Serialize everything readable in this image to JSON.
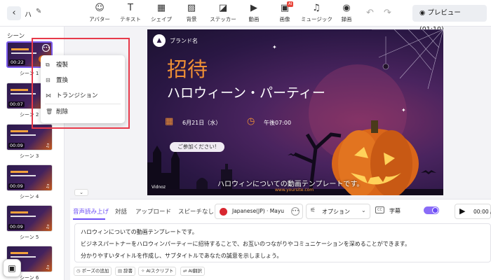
{
  "toolbar": {
    "back_icon": "chevron-left-icon",
    "project_name": "ハ",
    "tools": [
      {
        "label": "アバター",
        "icon": "avatar-icon",
        "glyph": "☺"
      },
      {
        "label": "テキスト",
        "icon": "text-icon",
        "glyph": "T"
      },
      {
        "label": "シェイプ",
        "icon": "shapes-icon",
        "glyph": "▦"
      },
      {
        "label": "背景",
        "icon": "background-icon",
        "glyph": "▨"
      },
      {
        "label": "ステッカー",
        "icon": "sticker-icon",
        "glyph": "◪"
      },
      {
        "label": "動画",
        "icon": "video-icon",
        "glyph": "▶"
      },
      {
        "label": "画像",
        "icon": "image-icon",
        "glyph": "▣",
        "badge": "AI"
      },
      {
        "label": "ミュージック",
        "icon": "music-icon",
        "glyph": "♫"
      },
      {
        "label": "録画",
        "icon": "record-icon",
        "glyph": "◉"
      }
    ],
    "preview_label": "プレビュー (01:10)"
  },
  "sidebar": {
    "title": "シーン",
    "scenes": [
      {
        "label": "シーン 1",
        "duration": "00:22"
      },
      {
        "label": "シーン 2",
        "duration": "00:07"
      },
      {
        "label": "シーン 3",
        "duration": "00:09"
      },
      {
        "label": "シーン 4",
        "duration": "00:09"
      },
      {
        "label": "シーン 5",
        "duration": "00:09"
      },
      {
        "label": "シーン 6",
        "duration": ""
      }
    ]
  },
  "context_menu": {
    "items": [
      {
        "label": "複製",
        "icon": "duplicate-icon"
      },
      {
        "label": "置換",
        "icon": "replace-icon"
      },
      {
        "label": "トランジション",
        "icon": "transition-icon"
      },
      {
        "label": "削除",
        "icon": "trash-icon"
      }
    ]
  },
  "canvas": {
    "brand_name": "ブランド名",
    "title": "招待",
    "subtitle": "ハロウィーン・パーティー",
    "date": "6月21日（水）",
    "time": "午後07:00",
    "rsvp": "ご参加ください!",
    "caption": "ハロウィンについての動画テンプレートです。",
    "url": "www.yoursite.com",
    "watermark": "Vidnoz"
  },
  "bottom_panel": {
    "tabs": [
      "音声読み上げ",
      "対話",
      "アップロード",
      "スピーチなし"
    ],
    "active_tab": "音声読み上げ",
    "voice": "Japanese(JP) · Mayu",
    "options_label": "オプション",
    "subtitle_label": "字幕",
    "subtitle_on": true,
    "play_time": "00:00 /",
    "script_lines": [
      "ハロウィンについての動画テンプレートです。",
      "ビジネスパートナーをハロウィンパーティーに招待することで、お互いのつながりやコミュニケーションを深めることができます。",
      "分かりやすいタイトルを作成し、サブタイトルであなたの誠意を示しましょう。"
    ],
    "chips": [
      {
        "label": "ポーズの追加",
        "icon": "clock-icon"
      },
      {
        "label": "辞書",
        "icon": "dictionary-icon"
      },
      {
        "label": "AIスクリプト",
        "icon": "ai-script-icon"
      },
      {
        "label": "AI翻訳",
        "icon": "ai-translate-icon"
      }
    ]
  },
  "colors": {
    "accent": "#6c4df6",
    "highlight_box": "#e73a4a",
    "title_orange": "#f09035"
  }
}
